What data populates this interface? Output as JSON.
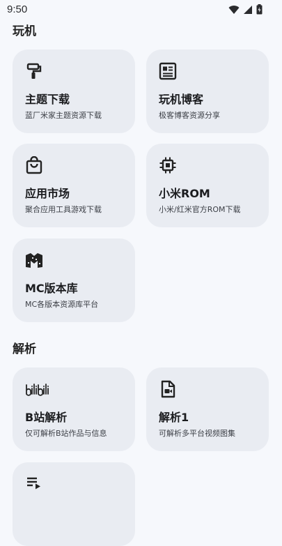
{
  "status": {
    "time": "9:50"
  },
  "sections": [
    {
      "title": "玩机",
      "cards": [
        {
          "title": "主题下载",
          "desc": "蓝厂米家主题资源下载",
          "icon": "paint-roller-icon"
        },
        {
          "title": "玩机博客",
          "desc": "极客博客资源分享",
          "icon": "article-icon"
        },
        {
          "title": "应用市场",
          "desc": "聚合应用工具游戏下载",
          "icon": "shopping-bag-icon"
        },
        {
          "title": "小米ROM",
          "desc": "小米/红米官方ROM下载",
          "icon": "chip-icon"
        },
        {
          "title": "MC版本库",
          "desc": "MC各版本资源库平台",
          "icon": "minecraft-logo-icon"
        }
      ]
    },
    {
      "title": "解析",
      "cards": [
        {
          "title": "B站解析",
          "desc": "仅可解析B站作品与信息",
          "icon": "bilibili-logo-icon"
        },
        {
          "title": "解析1",
          "desc": "可解析多平台视频图集",
          "icon": "video-file-icon"
        },
        {
          "title": "",
          "desc": "",
          "icon": "playlist-icon"
        }
      ]
    }
  ]
}
